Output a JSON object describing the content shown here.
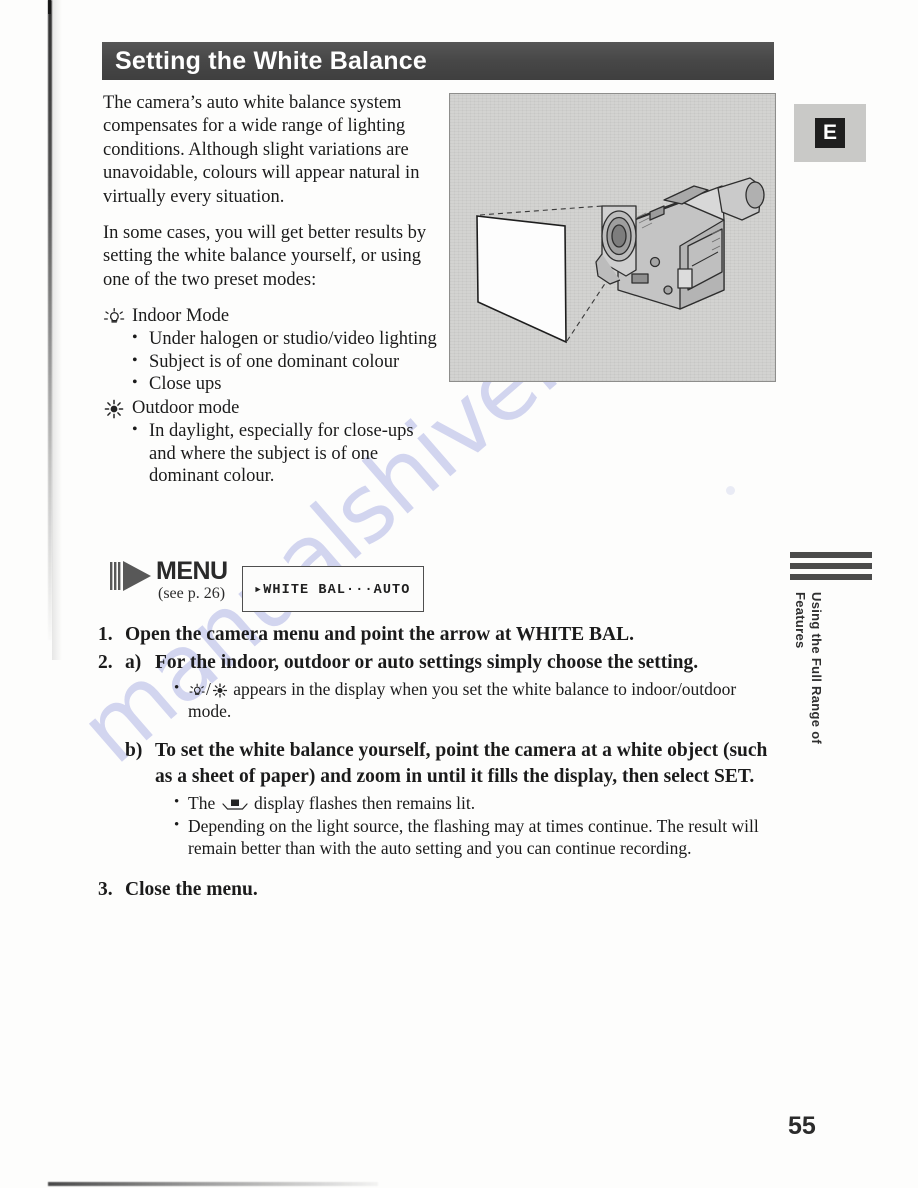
{
  "header": {
    "title": "Setting the White Balance"
  },
  "intro": {
    "paragraph_1": "The camera’s auto white balance system compensates for a wide range of lighting conditions. Although slight variations are unavoidable, colours will appear natural in virtually every situation.",
    "paragraph_2": "In some cases, you will get better results by setting the white balance yourself, or using one of the two preset modes:"
  },
  "modes": [
    {
      "icon": "indoor-lamp-icon",
      "label": "Indoor Mode",
      "bullets": [
        "Under halogen or studio/video lighting",
        "Subject is of one dominant colour",
        "Close ups"
      ]
    },
    {
      "icon": "outdoor-sun-icon",
      "label": "Outdoor mode",
      "bullets": [
        "In daylight, especially for close-ups and where the subject is of one dominant colour."
      ]
    }
  ],
  "menu_graphic": {
    "icon": "menu-triangle-icon",
    "word": "MENU",
    "see_reference": "(see p. 26)",
    "lcd_text": "▸WHITE BAL···AUTO"
  },
  "steps": [
    {
      "number": "1.",
      "title": "Open the camera menu and point the arrow at WHITE BAL."
    },
    {
      "number": "2.",
      "substeps": [
        {
          "letter": "a)",
          "title": "For the indoor, outdoor or auto settings simply choose the setting.",
          "notes_prefix": "",
          "notes": [
            "appears in the display when you set the white balance to indoor/outdoor mode."
          ]
        },
        {
          "letter": "b)",
          "title": "To set the white balance yourself, point the camera at a white object (such as a sheet of paper) and zoom in until it fills the display, then select SET.",
          "note_the": "The",
          "note_after_icon": "display flashes then remains lit.",
          "notes": [
            "Depending on the light source, the flashing may at times continue. The result will remain better than with the auto setting and you can continue recording."
          ]
        }
      ]
    },
    {
      "number": "3.",
      "title": "Close the menu."
    }
  ],
  "margin": {
    "language_tab": "E",
    "thumb_index_label": "Using the Full\nRange of Features",
    "page_number": "55"
  },
  "photo": {
    "alt": "Camcorder pointed at a white sheet of paper with dashed framing lines",
    "background_color": "#d3d3d1"
  },
  "watermark": {
    "text": "manualshive.com",
    "color": "#b9bde8"
  }
}
